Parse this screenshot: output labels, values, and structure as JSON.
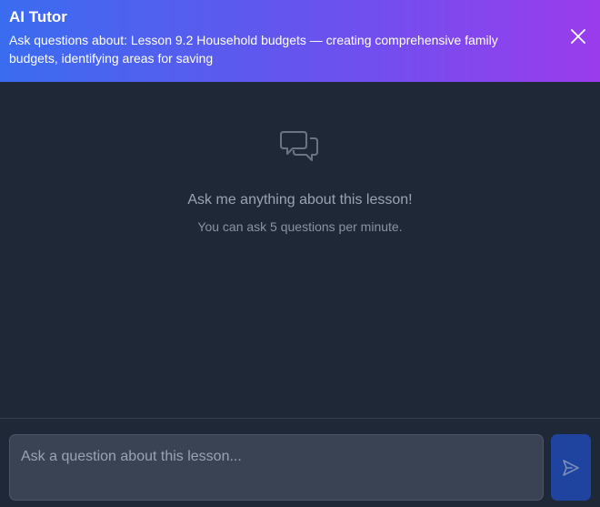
{
  "header": {
    "title": "AI Tutor",
    "subtitle": "Ask questions about: Lesson 9.2 Household budgets — creating comprehensive family budgets, identifying areas for saving",
    "close_icon": "close-icon",
    "gradient_start": "#3a6cf0",
    "gradient_end": "#9a3cec"
  },
  "empty_state": {
    "icon": "chat-bubbles-icon",
    "title": "Ask me anything about this lesson!",
    "subtitle": "You can ask 5 questions per minute."
  },
  "composer": {
    "placeholder": "Ask a question about this lesson...",
    "value": "",
    "send_icon": "send-icon",
    "send_color": "#1f44a0"
  }
}
